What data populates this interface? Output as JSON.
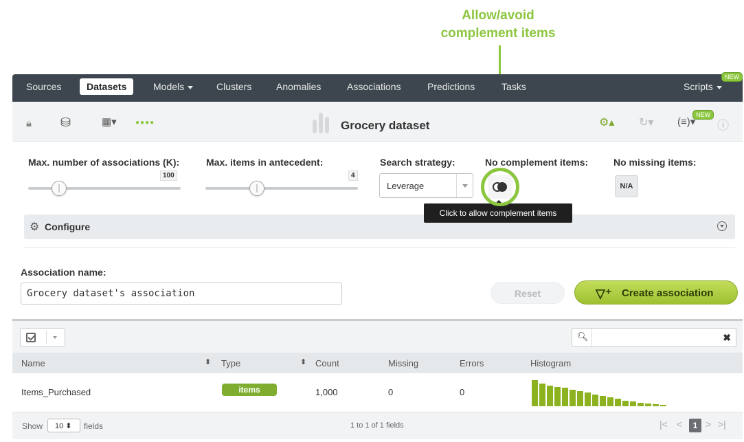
{
  "annotation": {
    "line1": "Allow/avoid",
    "line2": "complement items"
  },
  "nav": {
    "items": [
      {
        "label": "Sources"
      },
      {
        "label": "Datasets",
        "active": true
      },
      {
        "label": "Models",
        "dropdown": true
      },
      {
        "label": "Clusters"
      },
      {
        "label": "Anomalies"
      },
      {
        "label": "Associations"
      },
      {
        "label": "Predictions"
      },
      {
        "label": "Tasks"
      },
      {
        "label": "Scripts",
        "dropdown": true
      }
    ],
    "new_badge": "NEW"
  },
  "dataset": {
    "title": "Grocery dataset",
    "new_badge": "NEW"
  },
  "config": {
    "max_assoc_label": "Max. number of associations (K):",
    "max_assoc_value": "100",
    "max_antecedent_label": "Max. items in antecedent:",
    "max_antecedent_value": "4",
    "search_strategy_label": "Search strategy:",
    "search_strategy_value": "Leverage",
    "no_complement_label": "No complement items:",
    "no_missing_label": "No missing items:",
    "na_button": "N/A",
    "tooltip": "Click to allow complement items",
    "configure_label": "Configure"
  },
  "association": {
    "name_label": "Association name:",
    "name_value": "Grocery dataset's association",
    "reset_label": "Reset",
    "create_label": "Create association"
  },
  "table": {
    "headers": [
      "Name",
      "Type",
      "Count",
      "Missing",
      "Errors",
      "Histogram"
    ],
    "rows": [
      {
        "name": "Items_Purchased",
        "type": "items",
        "count": "1,000",
        "missing": "0",
        "errors": "0"
      }
    ],
    "histogram": [
      1.0,
      0.86,
      0.8,
      0.74,
      0.7,
      0.62,
      0.58,
      0.52,
      0.46,
      0.4,
      0.34,
      0.28,
      0.22,
      0.18,
      0.14,
      0.1,
      0.07,
      0.05
    ],
    "accent": "#8cb21f"
  },
  "footer": {
    "show_label": "Show",
    "show_value": "10",
    "fields_label": "fields",
    "range_label": "1 to 1 of 1 fields",
    "current_page": "1"
  }
}
